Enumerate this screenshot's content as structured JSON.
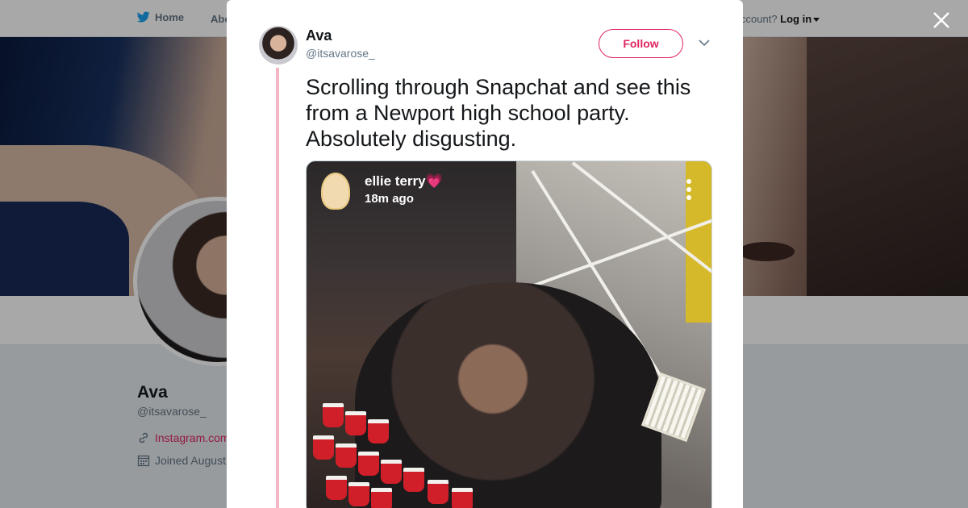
{
  "nav": {
    "home_label": "Home",
    "about_label": "Abo",
    "login_prefix": "ccount?",
    "login_label": "Log in"
  },
  "profile": {
    "name": "Ava",
    "handle": "@itsavarose_",
    "link": "Instagram.com",
    "joined": "Joined August"
  },
  "tweet": {
    "author_name": "Ava",
    "author_handle": "@itsavarose_",
    "follow_label": "Follow",
    "text": "Scrolling through Snapchat and see this from a Newport high school party. Absolutely disgusting."
  },
  "snap": {
    "user": "ellie terry💗",
    "time": "18m ago"
  },
  "colors": {
    "accent": "#e0245e",
    "thread_line": "#f3b5c2",
    "twitter_blue": "#1da1f2"
  },
  "icons": {
    "bird": "twitter-bird-icon",
    "close": "close-icon",
    "caret": "chevron-down-icon",
    "link": "link-icon",
    "calendar": "calendar-icon",
    "more": "more-vertical-icon"
  }
}
